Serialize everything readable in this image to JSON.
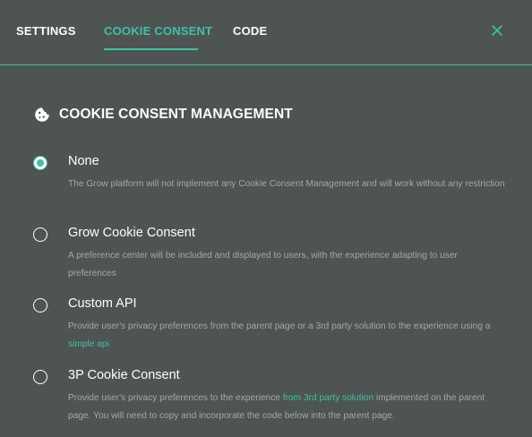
{
  "tabs": {
    "settings": "SETTINGS",
    "cookie_consent": "COOKIE CONSENT",
    "code": "CODE"
  },
  "section": {
    "title": "COOKIE CONSENT MANAGEMENT",
    "icon": "cookie-icon"
  },
  "options": [
    {
      "title": "None",
      "selected": true,
      "desc": "The Grow platform will not implement any Cookie Consent Management and will work without any restriction"
    },
    {
      "title": "Grow Cookie Consent",
      "selected": false,
      "desc": "A preference center will be included and displayed to users, with the experience adapting to user preferences"
    },
    {
      "title": "Custom API",
      "selected": false,
      "desc_before": "Provide user's privacy preferences from the parent page or a 3rd party solution to the experience using a ",
      "link": "simple api"
    },
    {
      "title": "3P Cookie Consent",
      "selected": false,
      "desc_before": "Provide user's privacy preferences to the experience ",
      "link": "from 3rd party solution",
      "desc_after": " implemented on the parent page. You will need to copy and incorporate the code below into the parent page."
    }
  ],
  "colors": {
    "background": "#4d5452",
    "accent": "#3fc1a7",
    "text": "#ffffff",
    "muted_text": "#a3a9a7"
  }
}
